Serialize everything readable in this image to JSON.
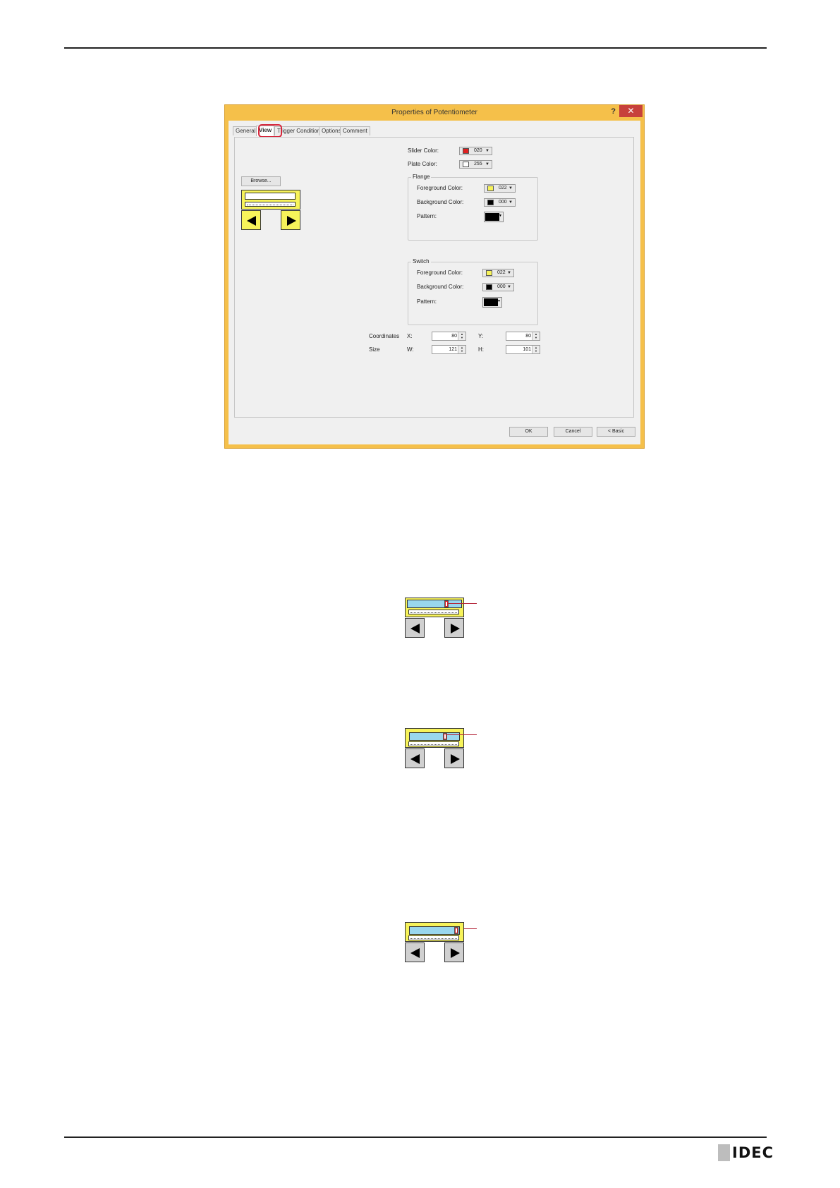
{
  "dialog": {
    "title": "Properties of Potentiometer",
    "help_label": "?",
    "close_label": "✕",
    "tabs": [
      {
        "label": "General"
      },
      {
        "label": "View"
      },
      {
        "label": "Trigger Condition"
      },
      {
        "label": "Options"
      },
      {
        "label": "Comment"
      }
    ],
    "browse_label": "Browse...",
    "slider_color": {
      "label": "Slider Color:",
      "value": "020",
      "swatch": "#e02020"
    },
    "plate_color": {
      "label": "Plate Color:",
      "value": "255",
      "swatch": "#ffffff"
    },
    "flange": {
      "title": "Flange",
      "foreground": {
        "label": "Foreground Color:",
        "value": "022",
        "swatch": "#f7f35a"
      },
      "background": {
        "label": "Background Color:",
        "value": "000",
        "swatch": "#000000"
      },
      "pattern_label": "Pattern:"
    },
    "switch": {
      "title": "Switch",
      "foreground": {
        "label": "Foreground Color:",
        "value": "022",
        "swatch": "#f7f35a"
      },
      "background": {
        "label": "Background Color:",
        "value": "000",
        "swatch": "#000000"
      },
      "pattern_label": "Pattern:"
    },
    "coordinates": {
      "label": "Coordinates",
      "x_label": "X:",
      "x": "80",
      "y_label": "Y:",
      "y": "80"
    },
    "size": {
      "label": "Size",
      "w_label": "W:",
      "w": "121",
      "h_label": "H:",
      "h": "101"
    },
    "ok_label": "OK",
    "cancel_label": "Cancel",
    "basic_label": "< Basic"
  },
  "footer": {
    "logo": "IDEC"
  }
}
